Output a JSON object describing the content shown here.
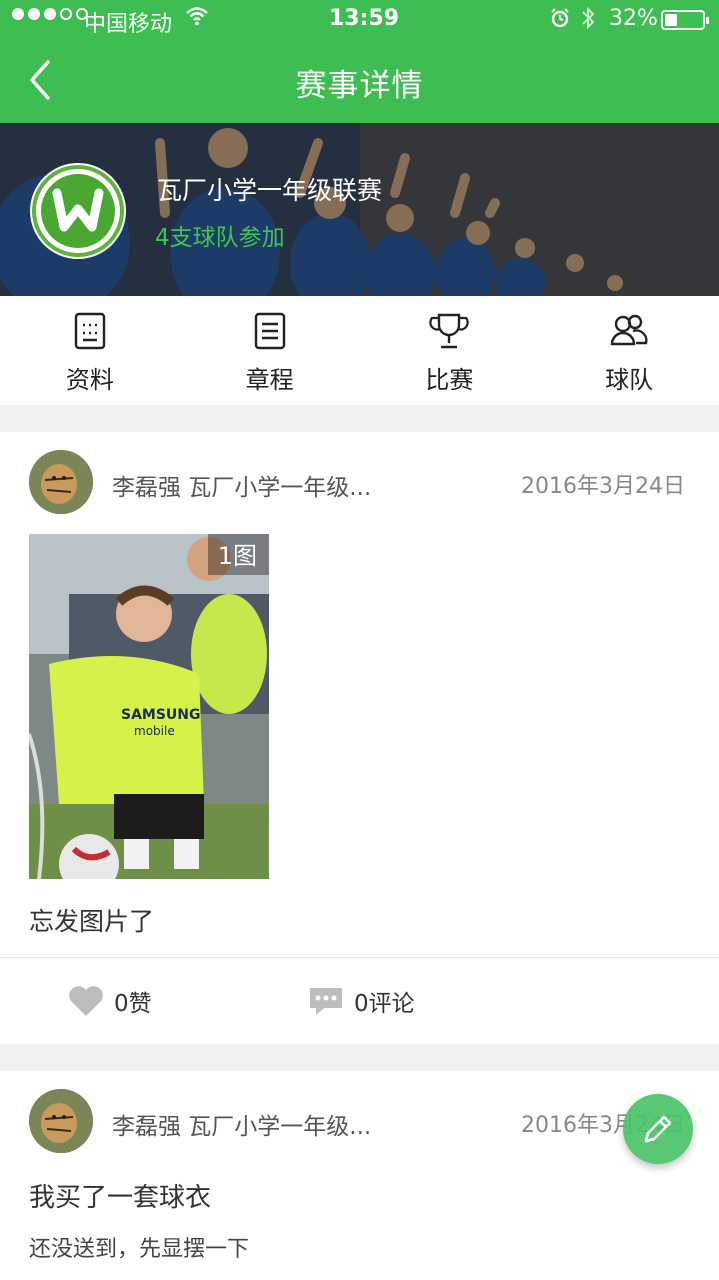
{
  "status": {
    "carrier": "中国移动",
    "time": "13:59",
    "battery": "32%",
    "battery_level": 0.32
  },
  "nav": {
    "title": "赛事详情"
  },
  "league": {
    "name": "瓦厂小学一年级联赛",
    "team_count": "4支球队参加"
  },
  "menu": {
    "items": [
      {
        "label": "资料",
        "icon": "profile-icon"
      },
      {
        "label": "章程",
        "icon": "document-icon"
      },
      {
        "label": "比赛",
        "icon": "trophy-icon"
      },
      {
        "label": "球队",
        "icon": "team-icon"
      }
    ]
  },
  "posts": [
    {
      "author": "李磊强 瓦厂小学一年级...",
      "date": "2016年3月24日",
      "photo_count": "1图",
      "text": "忘发图片了",
      "likes": "0赞",
      "comments": "0评论"
    },
    {
      "author": "李磊强 瓦厂小学一年级...",
      "date": "2016年3月24日",
      "title": "我买了一套球衣",
      "subtitle": "还没送到，先显摆一下"
    }
  ],
  "colors": {
    "brand": "#3dbd52",
    "accent_text": "#43c44f",
    "fab": "#4cc46a"
  }
}
